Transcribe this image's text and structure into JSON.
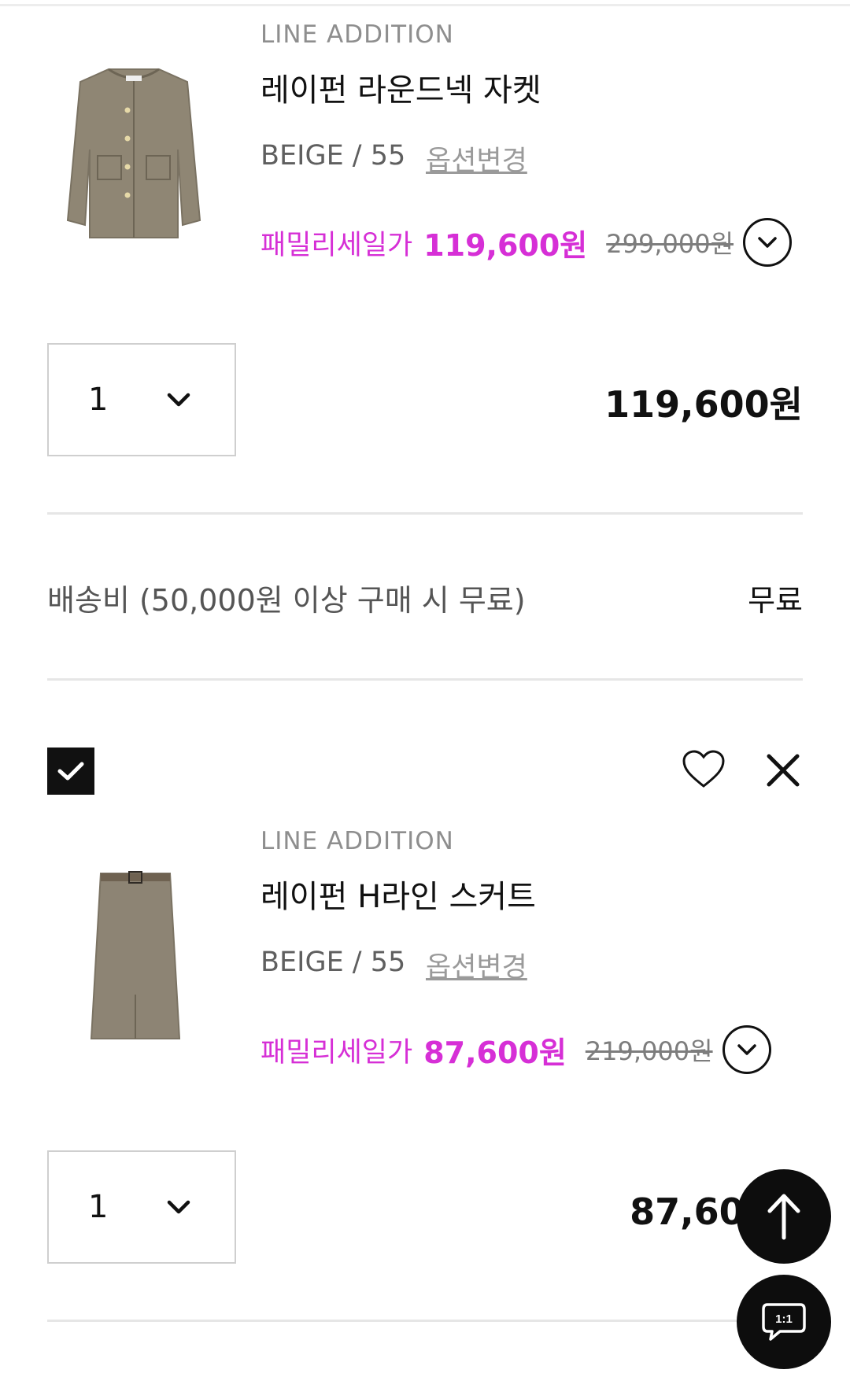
{
  "cart_items": [
    {
      "brand": "LINE ADDITION",
      "name": "레이펀 라운드넥 자켓",
      "option": "BEIGE / 55",
      "option_change_label": "옵션변경",
      "sale_label": "패밀리세일가",
      "sale_price": "119,600원",
      "original_price": "299,000원",
      "quantity": "1",
      "line_total": "119,600원",
      "image_icon": "jacket-image",
      "expand_icon": "chevron-down-circle-icon"
    },
    {
      "brand": "LINE ADDITION",
      "name": "레이펀 H라인 스커트",
      "option": "BEIGE / 55",
      "option_change_label": "옵션변경",
      "sale_label": "패밀리세일가",
      "sale_price": "87,600원",
      "original_price": "219,000원",
      "quantity": "1",
      "line_total": "87,600원",
      "image_icon": "skirt-image",
      "expand_icon": "chevron-down-circle-icon",
      "selected": true
    }
  ],
  "shipping": {
    "label": "배송비 (50,000원 이상 구매 시 무료)",
    "value": "무료"
  },
  "floating": {
    "top_icon": "arrow-up-icon",
    "chat_label": "1:1",
    "chat_icon": "chat-bubble-icon"
  },
  "colors": {
    "sale_accent": "#d62fd6",
    "text_primary": "#111111",
    "text_muted": "#8e8e8e",
    "divider": "#e6e6e6"
  }
}
